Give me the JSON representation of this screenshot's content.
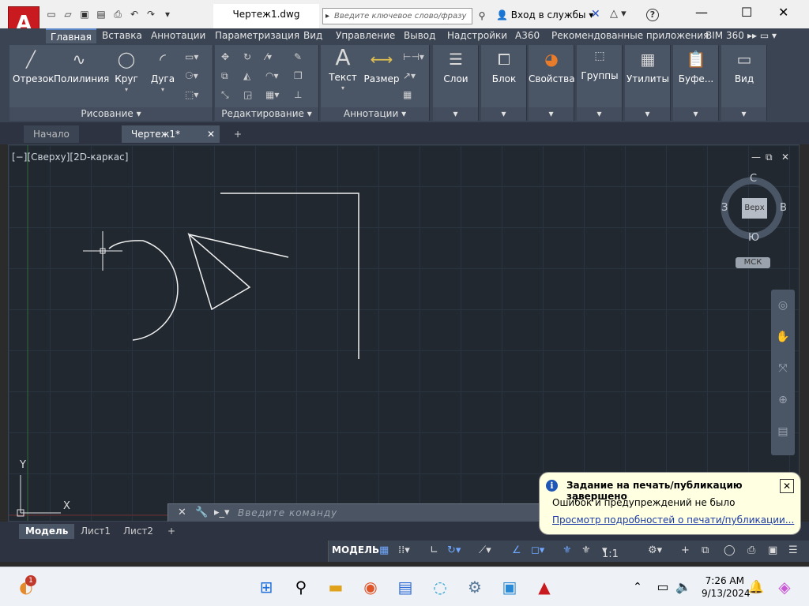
{
  "app": {
    "logo_letter": "A",
    "file_tab": "Чертеж1.dwg",
    "search_placeholder": "Введите ключевое слово/фразу",
    "login_label": "Вход в службы"
  },
  "ribbon_tabs": [
    "Главная",
    "Вставка",
    "Аннотации",
    "Параметризация",
    "Вид",
    "Управление",
    "Вывод",
    "Надстройки",
    "A360",
    "Рекомендованные приложения",
    "BIM 360"
  ],
  "ribbon": {
    "draw": {
      "title": "Рисование",
      "line": "Отрезок",
      "polyline": "Полилиния",
      "circle": "Круг",
      "arc": "Дуга"
    },
    "modify": {
      "title": "Редактирование"
    },
    "annotation": {
      "title": "Аннотации",
      "text": "Текст",
      "dimension": "Размер"
    },
    "layers": "Слои",
    "block": "Блок",
    "properties": "Свойства",
    "groups": "Группы",
    "utilities": "Утилиты",
    "clipboard": "Буфе...",
    "view": "Вид"
  },
  "doc_tabs": {
    "start": "Начало",
    "drawing": "Чертеж1*"
  },
  "viewport": {
    "label": "[−][Сверху][2D-каркас]",
    "viewcube": {
      "face": "Верх",
      "north": "С",
      "south": "Ю",
      "west": "З",
      "east": "В",
      "ucs": "МСК"
    },
    "ucs_x": "X",
    "ucs_y": "Y"
  },
  "command": {
    "placeholder": "Введите команду"
  },
  "layout_tabs": {
    "model": "Модель",
    "sheet1": "Лист1",
    "sheet2": "Лист2"
  },
  "status": {
    "model_button": "МОДЕЛЬ",
    "scale": "1:1"
  },
  "notification": {
    "title": "Задание на печать/публикацию завершено",
    "body": "Ошибок и предупреждений не было",
    "link": "Просмотр подробностей о печати/публикации..."
  },
  "taskbar": {
    "time": "7:26 AM",
    "date": "9/13/2024",
    "weather_badge": "1"
  },
  "colors": {
    "accent": "#c81a1f",
    "ribbon": "#3b4453",
    "canvas": "#212830"
  }
}
